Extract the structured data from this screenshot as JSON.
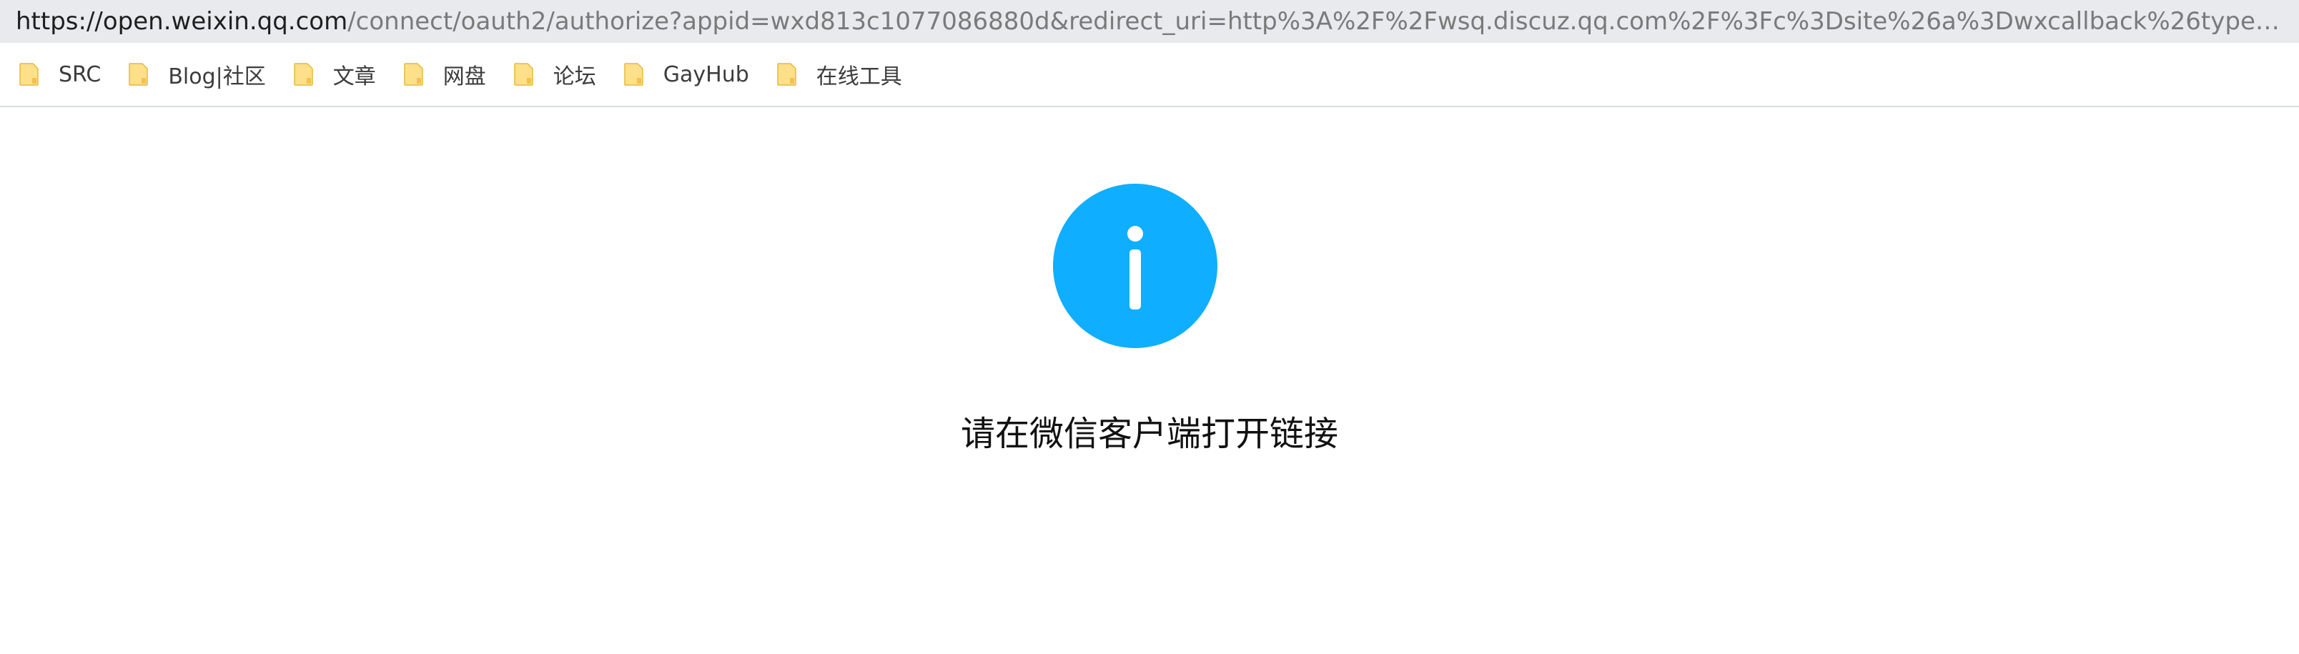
{
  "browser": {
    "url_host": "https://open.weixin.qq.com",
    "url_rest": "/connect/oauth2/authorize?appid=wxd813c1077086880d&redirect_uri=http%3A%2F%2Fwsq.discuz.qq.com%2F%3Fc%3Dsite%26a%3Dwxcallback%26type%3D..."
  },
  "bookmarks": [
    {
      "label": "SRC",
      "icon": "folder-icon"
    },
    {
      "label": "Blog|社区",
      "icon": "folder-icon"
    },
    {
      "label": "文章",
      "icon": "folder-icon"
    },
    {
      "label": "网盘",
      "icon": "folder-icon"
    },
    {
      "label": "论坛",
      "icon": "folder-icon"
    },
    {
      "label": "GayHub",
      "icon": "folder-icon"
    },
    {
      "label": "在线工具",
      "icon": "folder-icon"
    }
  ],
  "page": {
    "icon": "info-icon",
    "icon_color": "#10aeff",
    "message": "请在微信客户端打开链接"
  }
}
